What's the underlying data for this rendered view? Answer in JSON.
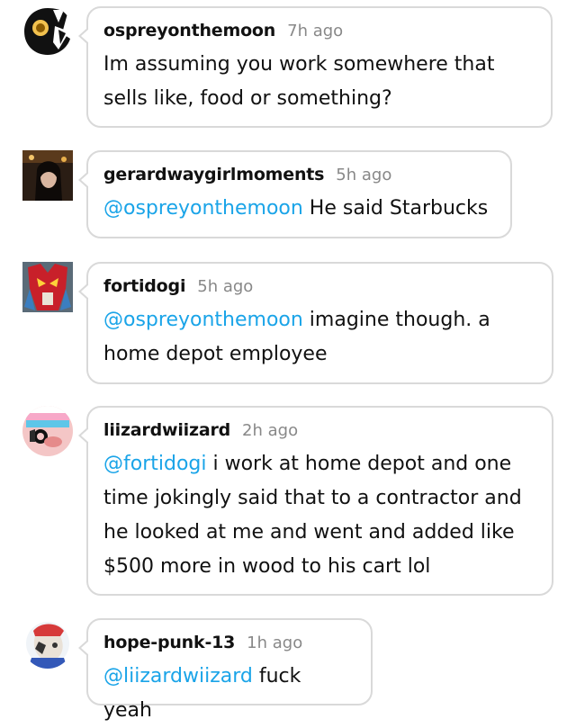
{
  "comments": [
    {
      "username": "ospreyonthemoon",
      "time": "7h ago",
      "avatar": "bird-avatar",
      "mention": "",
      "text": "Im assuming you work somewhere that sells like, food or something?"
    },
    {
      "username": "gerardwaygirlmoments",
      "time": "5h ago",
      "avatar": "photo-avatar",
      "mention": "@ospreyonthemoon",
      "text": " He said Starbucks"
    },
    {
      "username": "fortidogi",
      "time": "5h ago",
      "avatar": "robot-avatar",
      "mention": "@ospreyonthemoon",
      "text": " imagine though. a home depot employee"
    },
    {
      "username": "liizardwiizard",
      "time": "2h ago",
      "avatar": "character-avatar",
      "mention": "@fortidogi",
      "text": " i work at home depot and one time jokingly said that to a contractor and he looked at me and went and added like $500 more in wood to his cart lol"
    },
    {
      "username": "hope-punk-13",
      "time": "1h ago",
      "avatar": "drawing-avatar",
      "mention": "@liizardwiizard",
      "text": " fuck yeah"
    }
  ],
  "colors": {
    "mention": "#1aa4e8",
    "border": "#d9d9d9",
    "time": "#888888"
  }
}
